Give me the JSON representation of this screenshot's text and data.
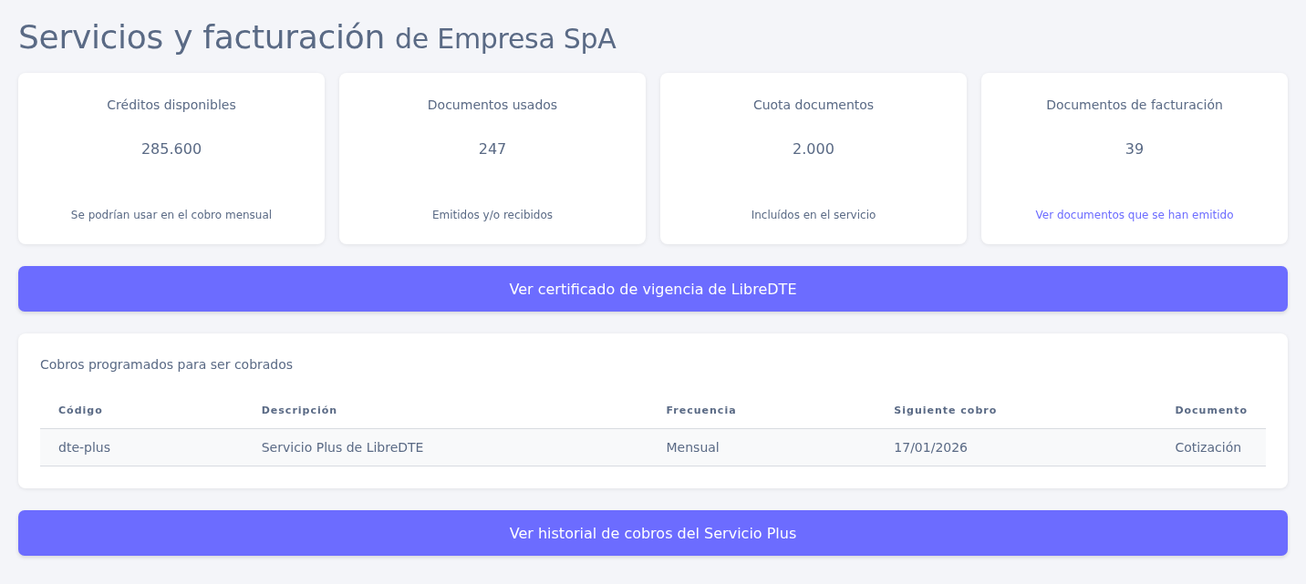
{
  "title": {
    "main": "Servicios y facturación",
    "company": "de Empresa SpA"
  },
  "cards": [
    {
      "label": "Créditos disponibles",
      "value": "285.600",
      "note": {
        "kind": "text",
        "text": "Se podrían usar en el cobro mensual"
      }
    },
    {
      "label": "Documentos usados",
      "value": "247",
      "note": {
        "kind": "text",
        "text": "Emitidos y/o recibidos"
      }
    },
    {
      "label": "Cuota documentos",
      "value": "2.000",
      "note": {
        "kind": "text",
        "text": "Incluídos en el servicio"
      }
    },
    {
      "label": "Documentos de facturación",
      "value": "39",
      "note": {
        "kind": "link",
        "text": "Ver documentos que se han emitido"
      }
    }
  ],
  "certificate_button": "Ver certificado de vigencia de LibreDTE",
  "scheduled": {
    "title": "Cobros programados para ser cobrados",
    "table": {
      "columns": [
        "Código",
        "Descripción",
        "Frecuencia",
        "Siguiente cobro",
        "Documento"
      ],
      "rows": [
        [
          "dte-plus",
          "Servicio Plus de LibreDTE",
          "Mensual",
          "17/01/2026",
          "Cotización"
        ]
      ]
    }
  },
  "history_button": "Ver historial de cobros del Servicio Plus"
}
